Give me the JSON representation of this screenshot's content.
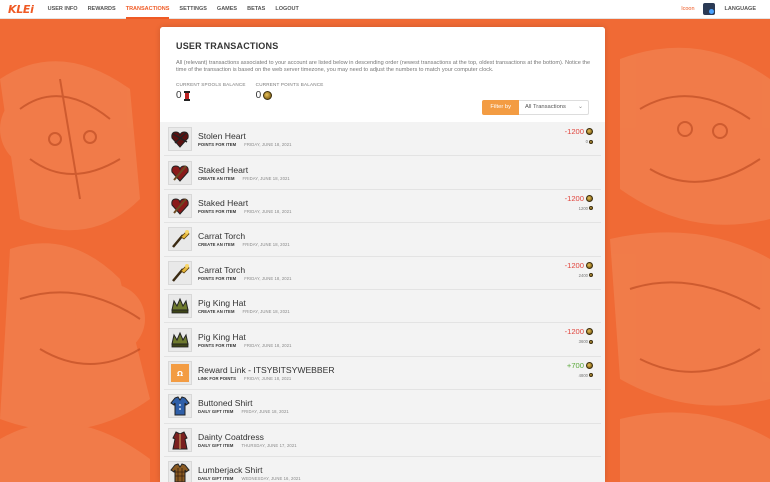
{
  "nav": {
    "logo": "KLEi",
    "items": [
      "USER INFO",
      "REWARDS",
      "TRANSACTIONS",
      "SETTINGS",
      "GAMES",
      "BETAS",
      "LOGOUT"
    ],
    "active_index": 2,
    "username": "lcoon",
    "language": "LANGUAGE"
  },
  "page": {
    "title": "USER TRANSACTIONS",
    "intro": "All (relevant) transactions associated to your account are listed below in descending order (newest transactions at the top, oldest transactions at the bottom). Notice the time of the transaction is based on the web server timezone, you may need to adjust the numbers to match your computer clock.",
    "spools_label": "CURRENT SPOOLS BALANCE",
    "spools_value": "0",
    "points_label": "CURRENT POINTS BALANCE",
    "points_value": "0",
    "filter_button": "Filter by",
    "filter_selected": "All Transactions"
  },
  "transactions": [
    {
      "name": "Stolen Heart",
      "type": "POINTS FOR ITEM",
      "date": "FRIDAY, JUNE 18, 2021",
      "amount": "-1200",
      "balance": "0",
      "icon": "stolen-heart-icon"
    },
    {
      "name": "Staked Heart",
      "type": "CREATE AN ITEM",
      "date": "FRIDAY, JUNE 18, 2021",
      "amount": "",
      "balance": "",
      "icon": "staked-heart-icon"
    },
    {
      "name": "Staked Heart",
      "type": "POINTS FOR ITEM",
      "date": "FRIDAY, JUNE 18, 2021",
      "amount": "-1200",
      "balance": "1200",
      "icon": "staked-heart-icon"
    },
    {
      "name": "Carrat Torch",
      "type": "CREATE AN ITEM",
      "date": "FRIDAY, JUNE 18, 2021",
      "amount": "",
      "balance": "",
      "icon": "carrat-torch-icon"
    },
    {
      "name": "Carrat Torch",
      "type": "POINTS FOR ITEM",
      "date": "FRIDAY, JUNE 18, 2021",
      "amount": "-1200",
      "balance": "2400",
      "icon": "carrat-torch-icon"
    },
    {
      "name": "Pig King Hat",
      "type": "CREATE AN ITEM",
      "date": "FRIDAY, JUNE 18, 2021",
      "amount": "",
      "balance": "",
      "icon": "pig-king-hat-icon"
    },
    {
      "name": "Pig King Hat",
      "type": "POINTS FOR ITEM",
      "date": "FRIDAY, JUNE 18, 2021",
      "amount": "-1200",
      "balance": "3600",
      "icon": "pig-king-hat-icon"
    },
    {
      "name": "Reward Link - ITSYBITSYWEBBER",
      "type": "LINK FOR POINTS",
      "date": "FRIDAY, JUNE 18, 2021",
      "amount": "+700",
      "balance": "4800",
      "icon": "reward-link-icon"
    },
    {
      "name": "Buttoned Shirt",
      "type": "DAILY GIFT ITEM",
      "date": "FRIDAY, JUNE 18, 2021",
      "amount": "",
      "balance": "",
      "icon": "buttoned-shirt-icon"
    },
    {
      "name": "Dainty Coatdress",
      "type": "DAILY GIFT ITEM",
      "date": "THURSDAY, JUNE 17, 2021",
      "amount": "",
      "balance": "",
      "icon": "dainty-coatdress-icon"
    },
    {
      "name": "Lumberjack Shirt",
      "type": "DAILY GIFT ITEM",
      "date": "WEDNESDAY, JUNE 16, 2021",
      "amount": "",
      "balance": "",
      "icon": "lumberjack-shirt-icon"
    }
  ],
  "colors": {
    "accent": "#ef5a24",
    "background": "#f06a35",
    "negative": "#e0443c",
    "positive": "#5aa83a",
    "filter_button": "#f39c43"
  }
}
